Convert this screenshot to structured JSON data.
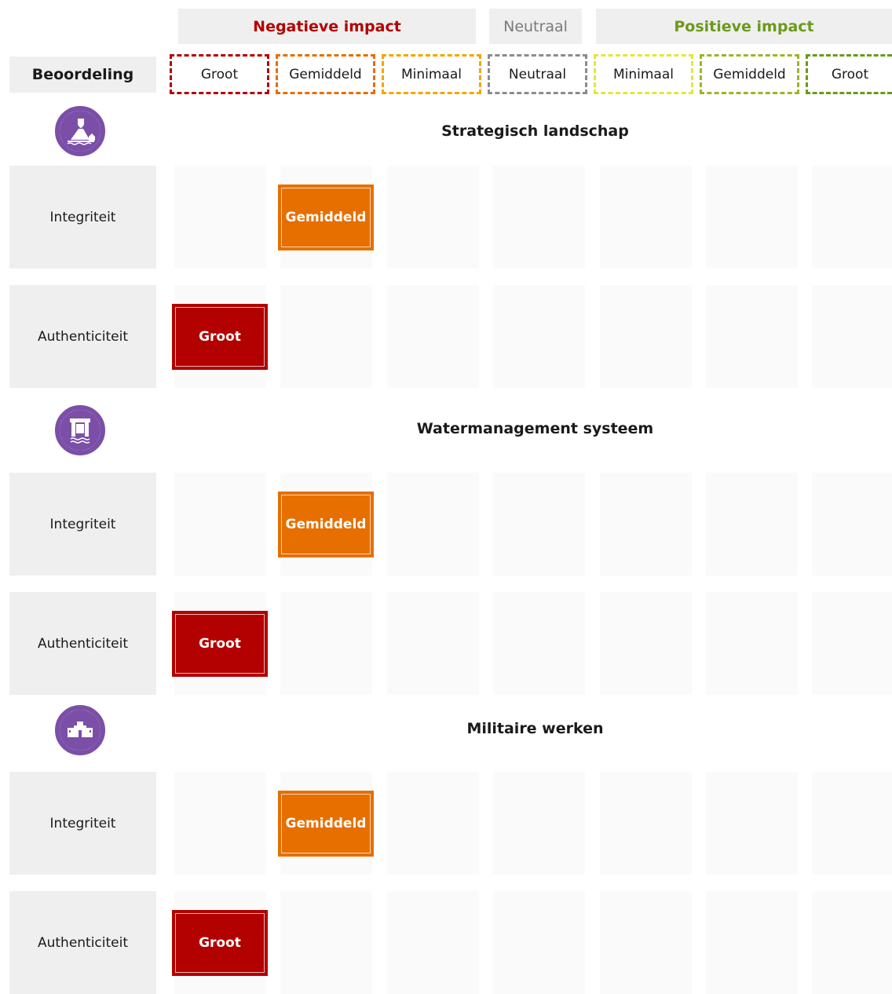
{
  "header": {
    "groups": {
      "negative": "Negatieve impact",
      "neutral": "Neutraal",
      "positive": "Positieve impact"
    },
    "rating_label": "Beoordeling",
    "scale": [
      {
        "label": "Groot",
        "color": "#b30000"
      },
      {
        "label": "Gemiddeld",
        "color": "#e66f00"
      },
      {
        "label": "Minimaal",
        "color": "#f2a600"
      },
      {
        "label": "Neutraal",
        "color": "#8c8c8c"
      },
      {
        "label": "Minimaal",
        "color": "#e3e63a"
      },
      {
        "label": "Gemiddeld",
        "color": "#9bb52a"
      },
      {
        "label": "Groot",
        "color": "#6a9a1a"
      }
    ]
  },
  "sections": [
    {
      "title": "Strategisch landschap",
      "icon": "fortified-landscape-icon",
      "rows": [
        {
          "label": "Integriteit",
          "impact": "Gemiddeld",
          "column": 1
        },
        {
          "label": "Authenticiteit",
          "impact": "Groot",
          "column": 0
        }
      ]
    },
    {
      "title": "Watermanagement systeem",
      "icon": "sluice-gate-icon",
      "rows": [
        {
          "label": "Integriteit",
          "impact": "Gemiddeld",
          "column": 1
        },
        {
          "label": "Authenticiteit",
          "impact": "Groot",
          "column": 0
        }
      ]
    },
    {
      "title": "Militaire werken",
      "icon": "fortress-icon",
      "rows": [
        {
          "label": "Integriteit",
          "impact": "Gemiddeld",
          "column": 1
        },
        {
          "label": "Authenticiteit",
          "impact": "Groot",
          "column": 0
        }
      ]
    }
  ],
  "colors": {
    "icon_purple": "#7b4fa8",
    "impact_groot": "#b30000",
    "impact_gemiddeld": "#e66f00"
  }
}
